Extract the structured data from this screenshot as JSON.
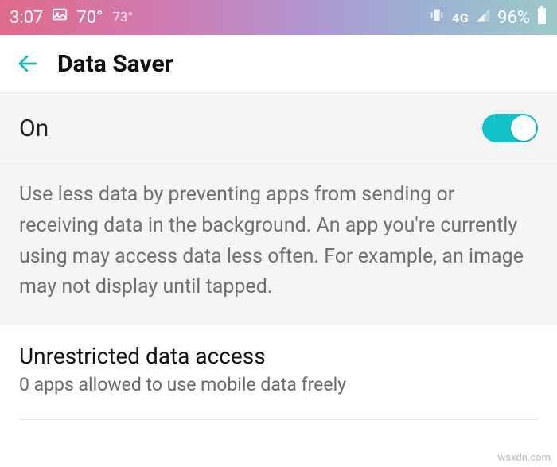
{
  "status": {
    "time": "3:07",
    "temp_primary": "70°",
    "temp_secondary": "73°",
    "network_label": "4G",
    "battery_percent": "96%"
  },
  "header": {
    "title": "Data Saver"
  },
  "toggle": {
    "label": "On",
    "state": "on"
  },
  "description": "Use less data by preventing apps from sending or receiving data in the background. An app you're currently using may access data less often. For example, an image may not display until tapped.",
  "unrestricted": {
    "title": "Unrestricted data access",
    "subtitle": "0 apps allowed to use mobile data freely"
  },
  "watermark": "wsxdn.com"
}
